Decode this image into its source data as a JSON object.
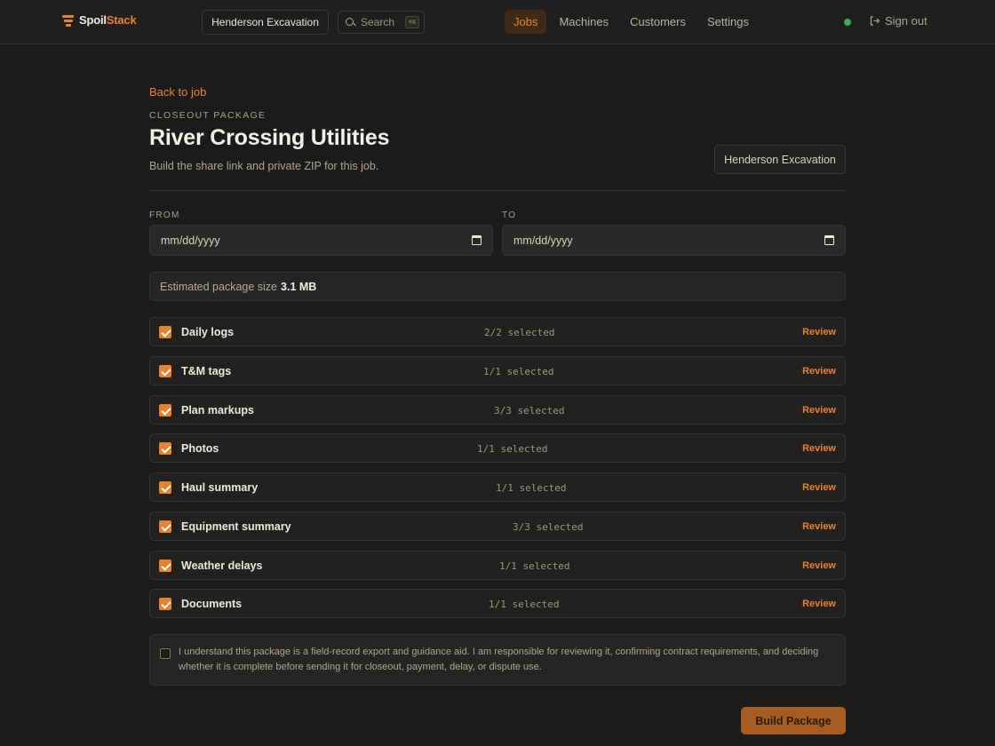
{
  "app": {
    "name_part1": "Spoil",
    "name_part2": "Stack"
  },
  "header": {
    "org": "Henderson Excavation",
    "search": {
      "label": "Search",
      "shortcut": "⌘K"
    },
    "nav": [
      {
        "label": "Jobs",
        "active": true
      },
      {
        "label": "Machines",
        "active": false
      },
      {
        "label": "Customers",
        "active": false
      },
      {
        "label": "Settings",
        "active": false
      }
    ],
    "signout": "Sign out"
  },
  "page": {
    "back": "Back to job",
    "eyebrow": "CLOSEOUT PACKAGE",
    "title": "River Crossing Utilities",
    "subtitle": "Build the share link and private ZIP for this job.",
    "customer": "Henderson Excavation"
  },
  "dates": {
    "from": {
      "label": "FROM",
      "value": "mm/dd/yyyy"
    },
    "to": {
      "label": "TO",
      "value": "mm/dd/yyyy"
    }
  },
  "estimate": {
    "label": "Estimated package size",
    "value": "3.1 MB"
  },
  "sections": [
    {
      "label": "Daily logs",
      "count": "2/2 selected",
      "review": "Review",
      "checked": true
    },
    {
      "label": "T&M tags",
      "count": "1/1 selected",
      "review": "Review",
      "checked": true
    },
    {
      "label": "Plan markups",
      "count": "3/3 selected",
      "review": "Review",
      "checked": true
    },
    {
      "label": "Photos",
      "count": "1/1 selected",
      "review": "Review",
      "checked": true
    },
    {
      "label": "Haul summary",
      "count": "1/1 selected",
      "review": "Review",
      "checked": true
    },
    {
      "label": "Equipment summary",
      "count": "3/3 selected",
      "review": "Review",
      "checked": true
    },
    {
      "label": "Weather delays",
      "count": "1/1 selected",
      "review": "Review",
      "checked": true
    },
    {
      "label": "Documents",
      "count": "1/1 selected",
      "review": "Review",
      "checked": true
    }
  ],
  "acknowledgement": {
    "checked": false,
    "text": "I understand this package is a field-record export and guidance aid. I am responsible for reviewing it, confirming contract requirements, and deciding whether it is complete before sending it for closeout, payment, delay, or dispute use."
  },
  "build_button": "Build Package",
  "colors": {
    "accent": "#e8822c",
    "status_online": "#3aad5a"
  }
}
